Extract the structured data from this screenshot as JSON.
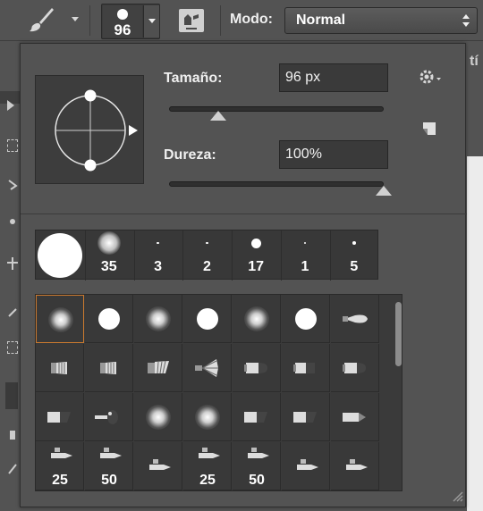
{
  "options_bar": {
    "brush_preset_size": "96",
    "mode_label": "Modo:",
    "mode_value": "Normal"
  },
  "brush_panel": {
    "size_label": "Tamaño:",
    "size_value": "96 px",
    "size_slider_fraction": 0.23,
    "hardness_label": "Dureza:",
    "hardness_value": "100%",
    "hardness_slider_fraction": 1.0
  },
  "recent_brushes": [
    {
      "size": "",
      "style": "hard"
    },
    {
      "size": "35",
      "style": "soft"
    },
    {
      "size": "3",
      "style": "hard"
    },
    {
      "size": "2",
      "style": "hard"
    },
    {
      "size": "17",
      "style": "hard"
    },
    {
      "size": "1",
      "style": "hard"
    },
    {
      "size": "5",
      "style": "hard"
    }
  ],
  "brush_grid": [
    [
      {
        "kind": "soft",
        "label": ""
      },
      {
        "kind": "hard",
        "label": ""
      },
      {
        "kind": "soft",
        "label": ""
      },
      {
        "kind": "hard",
        "label": ""
      },
      {
        "kind": "soft",
        "label": ""
      },
      {
        "kind": "hard",
        "label": ""
      },
      {
        "kind": "tip-a",
        "label": ""
      }
    ],
    [
      {
        "kind": "bristle-a",
        "label": ""
      },
      {
        "kind": "bristle-a",
        "label": ""
      },
      {
        "kind": "bristle-b",
        "label": ""
      },
      {
        "kind": "fan",
        "label": ""
      },
      {
        "kind": "bullet",
        "label": ""
      },
      {
        "kind": "flat",
        "label": ""
      },
      {
        "kind": "bullet",
        "label": ""
      }
    ],
    [
      {
        "kind": "angle",
        "label": ""
      },
      {
        "kind": "blunt",
        "label": ""
      },
      {
        "kind": "soft",
        "label": ""
      },
      {
        "kind": "soft",
        "label": ""
      },
      {
        "kind": "angle",
        "label": ""
      },
      {
        "kind": "angle",
        "label": ""
      },
      {
        "kind": "tip-b",
        "label": ""
      }
    ],
    [
      {
        "kind": "pen",
        "label": "25"
      },
      {
        "kind": "pen",
        "label": "50"
      },
      {
        "kind": "pen",
        "label": ""
      },
      {
        "kind": "pen",
        "label": "25"
      },
      {
        "kind": "pen",
        "label": "50"
      },
      {
        "kind": "pen",
        "label": ""
      },
      {
        "kind": "pen",
        "label": ""
      }
    ]
  ],
  "selected_cell": [
    0,
    0
  ],
  "grid_scroll_fraction": 0.0,
  "colors": {
    "accent_selection": "#c9792f",
    "panel_bg": "#535353",
    "well_bg": "#3a3a3a"
  },
  "icons": [
    "brush-tool-icon",
    "airbrush-icon",
    "gear-icon",
    "new-preset-icon",
    "resize-grip-icon"
  ]
}
